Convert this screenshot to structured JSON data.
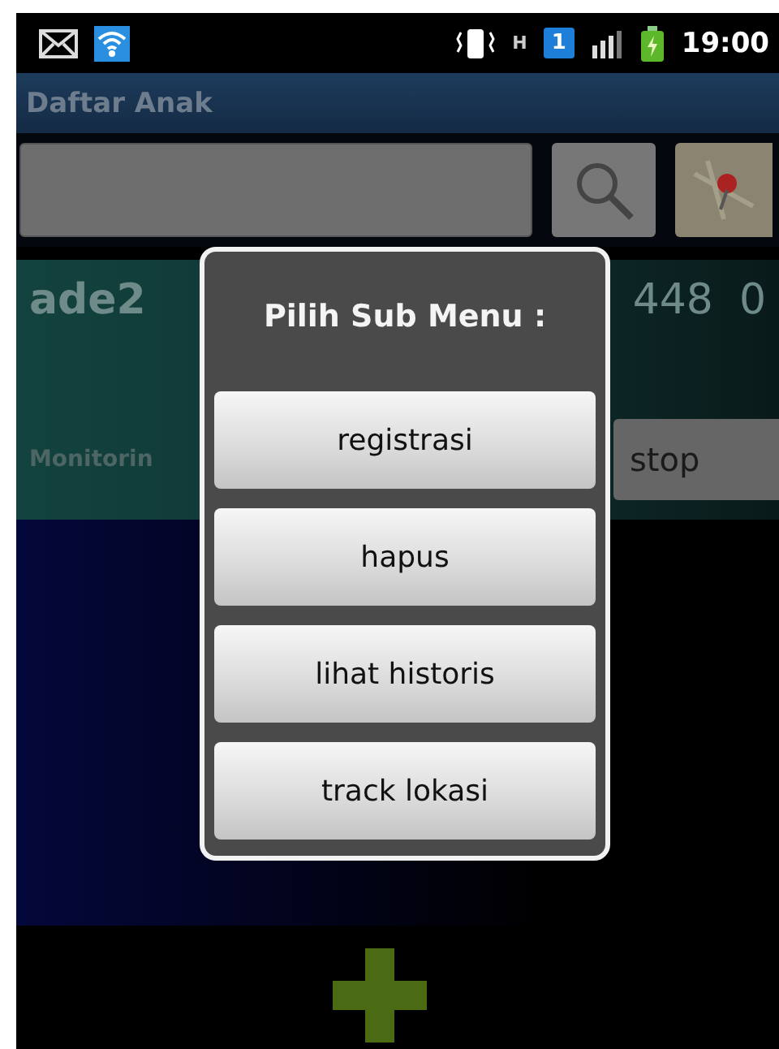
{
  "status_bar": {
    "time": "19:00",
    "network": "H",
    "sim": "1"
  },
  "title_bar": {
    "title": "Daftar Anak"
  },
  "child_card": {
    "name": "ade2",
    "column_2": "448",
    "column_3": "0",
    "label": "Monitorin",
    "stop_button": "stop"
  },
  "dialog": {
    "title": "Pilih Sub Menu :",
    "options": [
      "registrasi",
      "hapus",
      "lihat historis",
      "track lokasi"
    ]
  }
}
